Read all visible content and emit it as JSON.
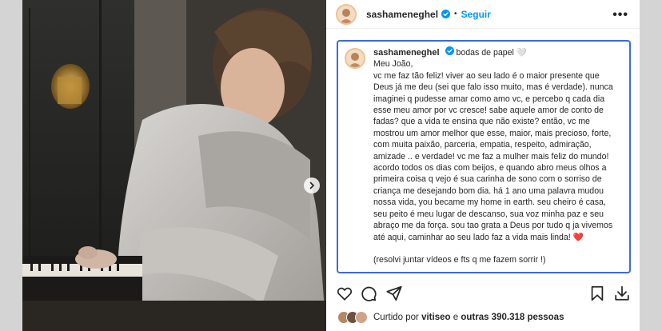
{
  "post": {
    "username": "sashameneghel",
    "follow_label": "Seguir",
    "more_label": "•••"
  },
  "caption": {
    "username": "sashameneghel",
    "first_line": "bodas de papel 🤍",
    "text": "Meu João,\nvc me faz tão feliz! viver ao seu lado é o maior presente que Deus já me deu (sei que falo isso muito, mas é verdade). nunca imaginei q pudesse amar como amo vc, e percebo q cada dia esse meu amor por vc cresce! sabe aquele amor de conto de fadas? que a vida te ensina que não existe? então, vc me mostrou um amor melhor que esse, maior, mais precioso, forte, com muita paixão, parceria, empatia, respeito, admiração, amizade .. e verdade! vc me faz a mulher mais feliz do mundo! acordo todos os dias com beijos, e quando abro meus olhos a primeira coisa q vejo é sua carinha de sono com o sorriso de criança me desejando bom dia. há 1 ano uma palavra mudou nossa vida, you became my home in earth. seu cheiro é casa, seu peito é meu lugar de descanso, sua voz minha paz e seu abraço me da força. sou tao grata a Deus por tudo q ja vivemos até aqui, caminhar ao seu lado faz a vida mais linda! ❤️",
    "extra": "(resolvi juntar vídeos e fts q me fazem sorrir !)"
  },
  "likes": {
    "prefix": "Curtido por",
    "user": "vitiseo",
    "connector": "e",
    "others": "outras 390.318 pessoas"
  },
  "icons": {
    "verified": "verified-badge-icon",
    "like": "heart-icon",
    "comment": "comment-icon",
    "share": "paper-plane-icon",
    "save": "bookmark-icon",
    "download": "download-icon",
    "next": "chevron-right-icon"
  },
  "colors": {
    "accent": "#0095f6",
    "caption_border": "#3d6bd6"
  }
}
